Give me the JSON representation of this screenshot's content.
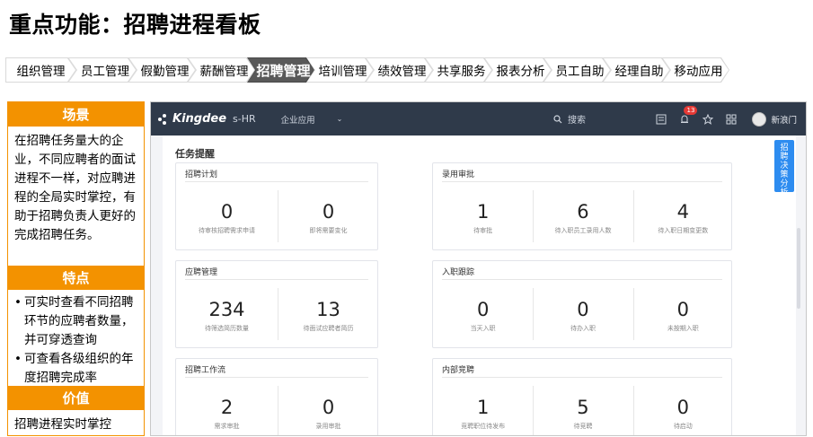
{
  "title": "重点功能：招聘进程看板",
  "modules": [
    "组织管理",
    "员工管理",
    "假勤管理",
    "薪酬管理",
    "招聘管理",
    "培训管理",
    "绩效管理",
    "共享服务",
    "报表分析",
    "员工自助",
    "经理自助",
    "移动应用"
  ],
  "active_module": "招聘管理",
  "info": {
    "scene_title": "场景",
    "scene_text": "在招聘任务量大的企业，不同应聘者的面试进程不一样，对应聘进程的全局实时掌控，有助于招聘负责人更好的完成招聘任务。",
    "features_title": "特点",
    "features": [
      "可实时查看不同招聘环节的应聘者数量，并可穿透查询",
      "可查看各级组织的年度招聘完成率"
    ],
    "value_title": "价值",
    "value_text": "招聘进程实时掌控"
  },
  "app": {
    "brand": "Kingdee",
    "product": "s-HR",
    "menu": "企业应用",
    "search_placeholder": "搜索",
    "message_badge": "13",
    "user_name": "新浪门",
    "section_title": "任务提醒",
    "side_tab": "招聘决策分析",
    "cards": [
      {
        "title": "招聘计划",
        "metrics": [
          {
            "value": "0",
            "label": "待审核招聘需求申请"
          },
          {
            "value": "0",
            "label": "即将需要变化"
          }
        ]
      },
      {
        "title": "录用审批",
        "metrics": [
          {
            "value": "1",
            "label": "待审批"
          },
          {
            "value": "6",
            "label": "待入职员工录用人数"
          },
          {
            "value": "4",
            "label": "待入职日期变更数"
          }
        ]
      },
      {
        "title": "应聘管理",
        "metrics": [
          {
            "value": "234",
            "label": "待筛选简历数量"
          },
          {
            "value": "13",
            "label": "待面试应聘者简历"
          }
        ]
      },
      {
        "title": "入职跟踪",
        "metrics": [
          {
            "value": "0",
            "label": "当天入职"
          },
          {
            "value": "0",
            "label": "待办入职"
          },
          {
            "value": "0",
            "label": "未按期入职"
          }
        ]
      },
      {
        "title": "招聘工作流",
        "metrics": [
          {
            "value": "2",
            "label": "需求审批"
          },
          {
            "value": "0",
            "label": "录用审批"
          }
        ]
      },
      {
        "title": "内部竞聘",
        "metrics": [
          {
            "value": "1",
            "label": "竞聘职位待发布"
          },
          {
            "value": "5",
            "label": "待竞聘"
          },
          {
            "value": "0",
            "label": "待启动"
          }
        ]
      }
    ]
  }
}
